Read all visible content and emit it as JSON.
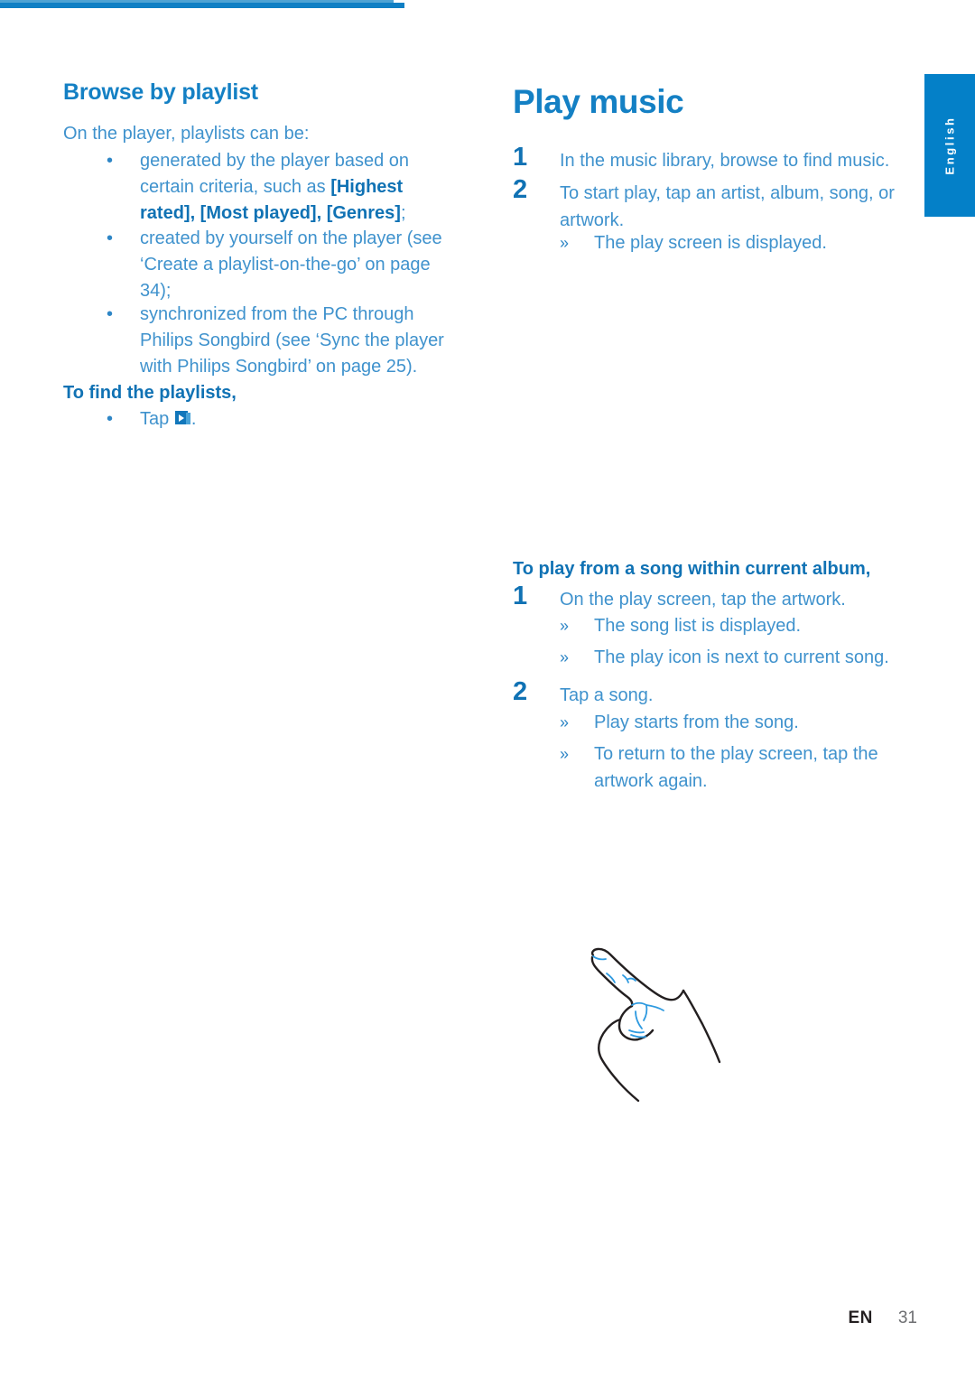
{
  "document": {
    "language_tab": "English",
    "footer": {
      "lang_code": "EN",
      "page_number": "31"
    },
    "colors": {
      "heading_blue": "#1480c4",
      "body_blue": "#3f92cd",
      "bold_blue": "#1072b4",
      "tab_blue": "#0480c8",
      "rule_left": "#4ea3d4",
      "rule_right": "#0f7fc4",
      "footer_dark": "#231f20",
      "footer_gray": "#6d6e71"
    }
  },
  "left_column": {
    "heading": "Browse by playlist",
    "intro": "On the player, playlists can be:",
    "bullets": [
      {
        "pre": "generated by the player based on certain criteria, such as ",
        "bold": "[Highest rated], [Most played], [Genres]",
        "post": ";"
      },
      {
        "pre": "created by yourself on the player (see ‘Create a playlist-on-the-go’ on page 34);",
        "bold": "",
        "post": ""
      },
      {
        "pre": "synchronized from the PC through Philips Songbird (see ‘Sync the player with Philips Songbird’ on page 25).",
        "bold": "",
        "post": ""
      }
    ],
    "find_heading": "To find the playlists,",
    "tap_prefix": "Tap",
    "tap_suffix": ".",
    "tap_icon": "playlist-icon"
  },
  "right_column": {
    "heading": "Play music",
    "steps": [
      {
        "num": "1",
        "text": "In the music library, browse to find music."
      },
      {
        "num": "2",
        "text": "To start play, tap an artist, album, song, or artwork."
      }
    ],
    "step_results": [
      {
        "marker": "»",
        "text": "The play screen is displayed."
      }
    ],
    "section2": {
      "heading": "To play from a song within current album,",
      "steps": [
        {
          "num": "1",
          "text": "On the play screen, tap the artwork.",
          "results": [
            {
              "marker": "»",
              "text": "The song list is displayed."
            },
            {
              "marker": "»",
              "text": "The play icon is next to current song."
            }
          ]
        },
        {
          "num": "2",
          "text": "Tap a song.",
          "results": [
            {
              "marker": "»",
              "text": "Play starts from the song."
            },
            {
              "marker": "»",
              "text": "To return to the play screen, tap the artwork again."
            }
          ]
        }
      ]
    },
    "illustration": "pointing-hand-illustration"
  }
}
